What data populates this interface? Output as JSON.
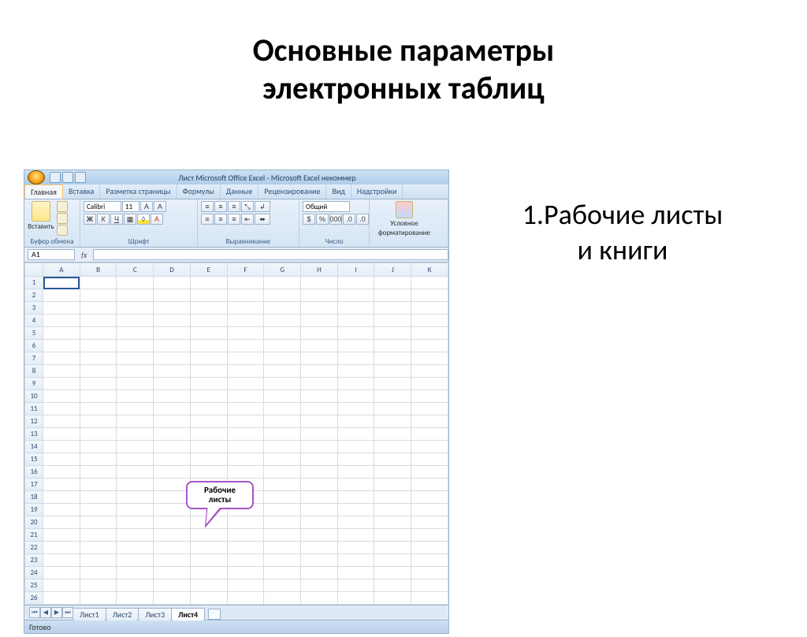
{
  "slide": {
    "title_l1": "Основные параметры",
    "title_l2": "электронных таблиц",
    "body_l1": "1.Рабочие листы",
    "body_l2": "и книги"
  },
  "excel": {
    "titlebar": "Лист Microsoft Office Excel - Microsoft Excel некоммер",
    "tabs": [
      "Главная",
      "Вставка",
      "Разметка страницы",
      "Формулы",
      "Данные",
      "Рецензирование",
      "Вид",
      "Надстройки"
    ],
    "ribbon": {
      "paste_label": "Вставить",
      "clipboard_group": "Буфер обмена",
      "font_name": "Calibri",
      "font_size": "11",
      "font_group": "Шрифт",
      "align_group": "Выравнивание",
      "number_format": "Общий",
      "number_group": "Число",
      "cond_fmt_l1": "Условное",
      "cond_fmt_l2": "форматирование",
      "styles_group": ""
    },
    "namebox": "A1",
    "fx_label": "fx",
    "columns": [
      "A",
      "B",
      "C",
      "D",
      "E",
      "F",
      "G",
      "H",
      "I",
      "J",
      "K"
    ],
    "rows": [
      "1",
      "2",
      "3",
      "4",
      "5",
      "6",
      "7",
      "8",
      "9",
      "10",
      "11",
      "12",
      "13",
      "14",
      "15",
      "16",
      "17",
      "18",
      "19",
      "20",
      "21",
      "22",
      "23",
      "24",
      "25",
      "26"
    ],
    "sheets": [
      "Лист1",
      "Лист2",
      "Лист3",
      "Лист4"
    ],
    "active_sheet_index": 3,
    "status": "Готово"
  },
  "callout": {
    "l1": "Рабочие",
    "l2": "листы"
  }
}
